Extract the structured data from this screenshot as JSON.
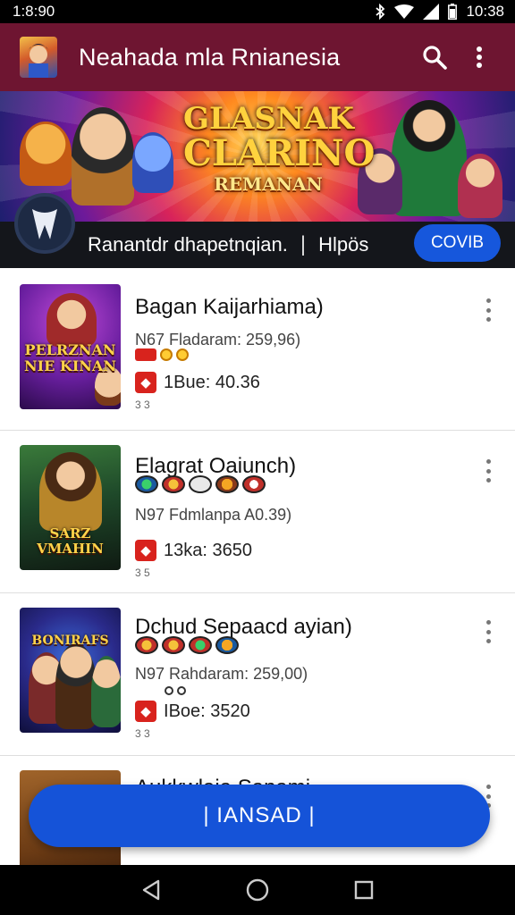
{
  "status_bar": {
    "time": "1:8:90",
    "clock_right": "10:38",
    "icons": [
      "bluetooth-icon",
      "wifi-icon",
      "signal-icon",
      "battery-icon"
    ]
  },
  "app_bar": {
    "title": "Neahada mla Rnianesia",
    "logo_icon": "app-logo-icon",
    "actions": [
      "search-icon",
      "more-vert-icon"
    ],
    "color": "#6e1531"
  },
  "banner": {
    "title_line1": "GLASNAK",
    "title_line2": "CLARINO",
    "title_line3": "REMANAN"
  },
  "promo": {
    "text": "Ranantdr dhapetnqian.",
    "separator": "|",
    "link": "Hlpös",
    "button_label": "COVIB",
    "button_color": "#1657dc"
  },
  "items": [
    {
      "title": "Bagan Kaijarhiama)",
      "meta": "N67 Fladaram: 259,96)",
      "price": "Bue: 40.36",
      "price_prefix": "1",
      "sub": "3 3",
      "thumb_label_1": "PELRZNAN",
      "thumb_label_2": "NIE KINAN"
    },
    {
      "title": "Elagrat Oaiunch)",
      "meta": "N97 Fdmlanpa A0.39)",
      "price": "3ka: 3650",
      "price_prefix": "1",
      "sub": "3 5",
      "thumb_label_1": "SARZ",
      "thumb_label_2": "VMAHIN"
    },
    {
      "title": "Dchud Sepaacd ayian)",
      "meta": "N97 Rahdaram: 259,00)",
      "price": "Boe: 3520",
      "price_prefix": "I",
      "sub": "3 3",
      "thumb_label_1": "BONIRAFS",
      "thumb_label_2": ""
    },
    {
      "title": "Aukkwlaia Sanami",
      "meta": "",
      "price": "",
      "price_prefix": "",
      "sub": "",
      "thumb_label_1": "",
      "thumb_label_2": ""
    }
  ],
  "fab": {
    "label": "| IANSAD |",
    "color": "#1553d8"
  },
  "nav": [
    "back-icon",
    "home-icon",
    "recents-icon"
  ]
}
